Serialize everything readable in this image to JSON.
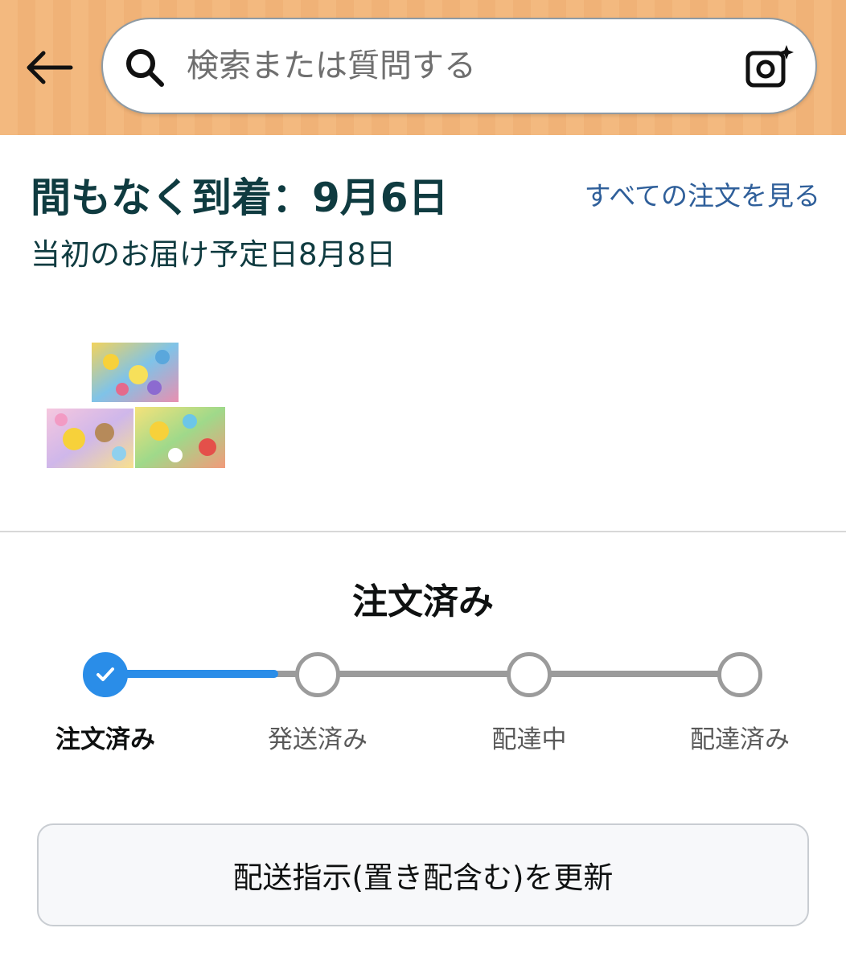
{
  "search": {
    "placeholder": "検索または質問する"
  },
  "icons": {
    "back": "arrow-left-icon",
    "search": "magnifier-icon",
    "camera": "camera-sparkle-icon",
    "check": "checkmark-icon"
  },
  "delivery": {
    "title": "間もなく到着：9月6日",
    "original_date": "当初のお届け予定日8月8日",
    "all_orders_link": "すべての注文を見る"
  },
  "status": {
    "heading": "注文済み",
    "steps": [
      {
        "label": "注文済み",
        "done": true
      },
      {
        "label": "発送済み",
        "done": false
      },
      {
        "label": "配達中",
        "done": false
      },
      {
        "label": "配達済み",
        "done": false
      }
    ],
    "progress_fraction": 0.25
  },
  "actions": {
    "update_delivery_label": "配送指示(置き配含む)を更新"
  },
  "colors": {
    "header_bg": "#f3b97f",
    "accent": "#2a8de8",
    "link": "#2f5f9a",
    "title_text": "#0f3b40"
  }
}
